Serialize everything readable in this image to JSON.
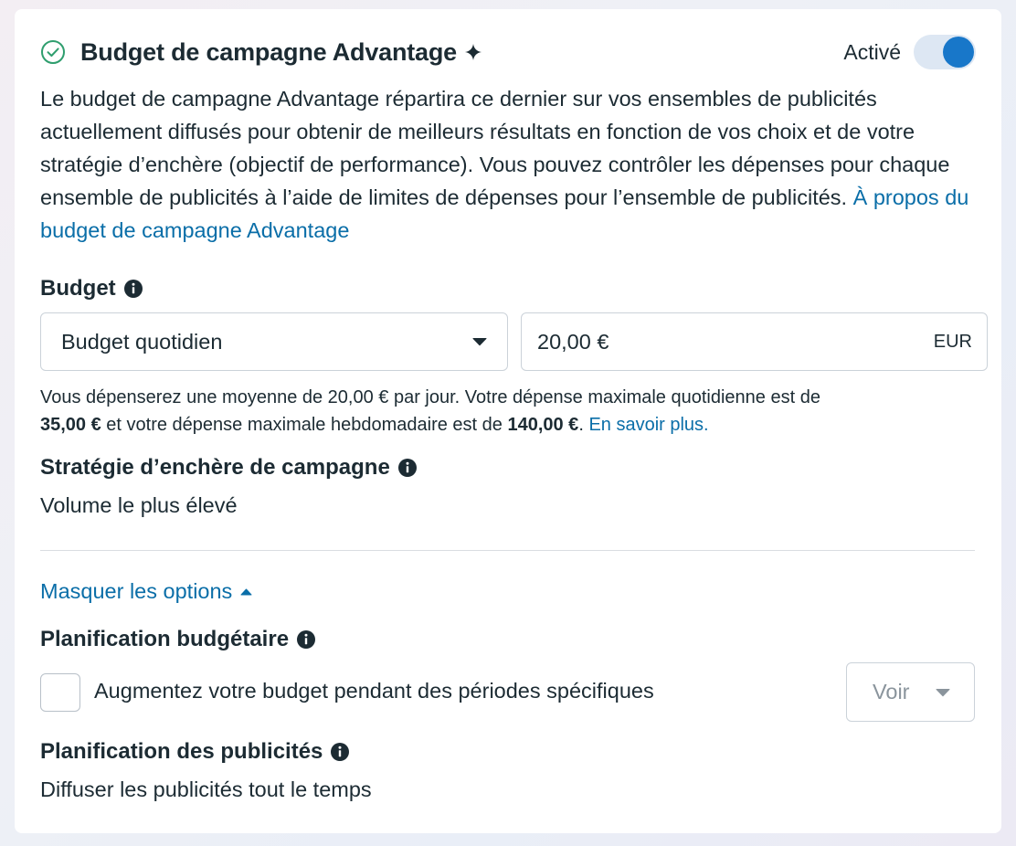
{
  "header": {
    "title": "Budget de campagne Advantage",
    "toggle_label": "Activé",
    "toggle_on": true
  },
  "description": {
    "text": "Le budget de campagne Advantage répartira ce dernier sur vos ensembles de publicités actuellement diffusés pour obtenir de meilleurs résultats en fonction de vos choix et de votre stratégie d’enchère (objectif de performance). Vous pouvez contrôler les dépenses pour chaque ensemble de publicités à l’aide de limites de dépenses pour l’ensemble de publicités.",
    "link": "À propos du budget de campagne Advantage"
  },
  "budget": {
    "label": "Budget",
    "type_selected": "Budget quotidien",
    "amount": "20,00 €",
    "currency": "EUR",
    "note_part1": "Vous dépenserez une moyenne de 20,00 € par jour. Votre dépense maximale quotidienne est de",
    "note_daily_max": "35,00 €",
    "note_part2": "et votre dépense maximale hebdomadaire est de",
    "note_weekly_max": "140,00 €",
    "note_link": "En savoir plus."
  },
  "bid_strategy": {
    "label": "Stratégie d’enchère de campagne",
    "value": "Volume le plus élevé"
  },
  "options": {
    "toggle_label": "Masquer les options"
  },
  "budget_scheduling": {
    "label": "Planification budgétaire",
    "checkbox_label": "Augmentez votre budget pendant des périodes spécifiques",
    "checked": false,
    "view_button": "Voir"
  },
  "ad_scheduling": {
    "label": "Planification des publicités",
    "value": "Diffuser les publicités tout le temps"
  },
  "colors": {
    "accent": "#1877c9",
    "link": "#0a6ea8",
    "success": "#2f9e6e",
    "text": "#1c2b33"
  }
}
